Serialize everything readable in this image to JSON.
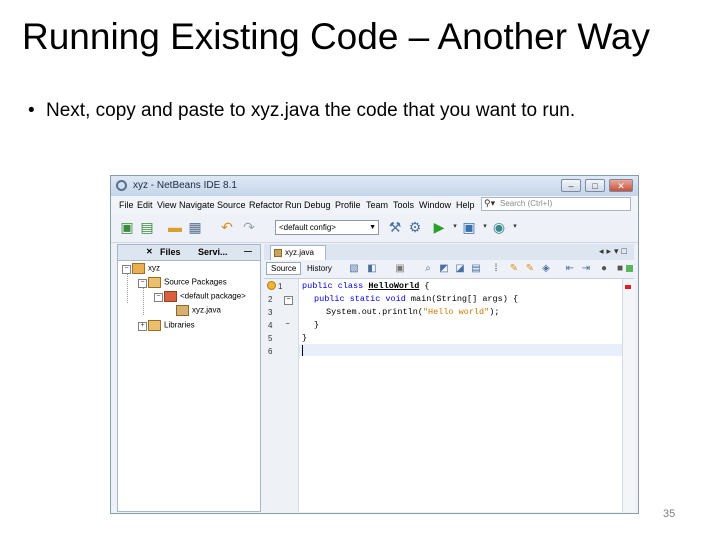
{
  "slide": {
    "title": "Running Existing Code – Another Way",
    "bullet": "Next, copy and paste to xyz.java the code that you want to run.",
    "page_number": "35"
  },
  "window": {
    "title": "xyz - NetBeans IDE 8.1",
    "min_label": "–",
    "max_label": "□",
    "close_label": "✕"
  },
  "menu": {
    "items": [
      "File",
      "Edit",
      "View",
      "Navigate",
      "Source",
      "Refactor",
      "Run",
      "Debug",
      "Profile",
      "Team",
      "Tools",
      "Window",
      "Help"
    ],
    "search_placeholder": "Search (Ctrl+I)"
  },
  "toolbar": {
    "config": "<default config>"
  },
  "project_panel": {
    "tabs": [
      "Files",
      "Servi..."
    ],
    "tree": {
      "project": "xyz",
      "source_packages": "Source Packages",
      "default_package": "<default package>",
      "file": "xyz.java",
      "libraries": "Libraries"
    }
  },
  "editor": {
    "tab": "xyz.java",
    "source_label": "Source",
    "history_label": "History",
    "line_numbers": [
      "1",
      "2",
      "3",
      "4",
      "5",
      "6"
    ],
    "code": {
      "l1_kw": "public class ",
      "l1_name": "HelloWorld",
      "l1_rest": " {",
      "l2_kw": "public static void ",
      "l2_rest": "main(String[] args) {",
      "l3_pre": "System.out.println(",
      "l3_str": "\"Hello world\"",
      "l3_post": ");",
      "l4": "}",
      "l5": "}"
    }
  },
  "colors": {
    "keyword": "#0000e6",
    "string": "#ce7b00",
    "error_mark": "#e02020"
  }
}
